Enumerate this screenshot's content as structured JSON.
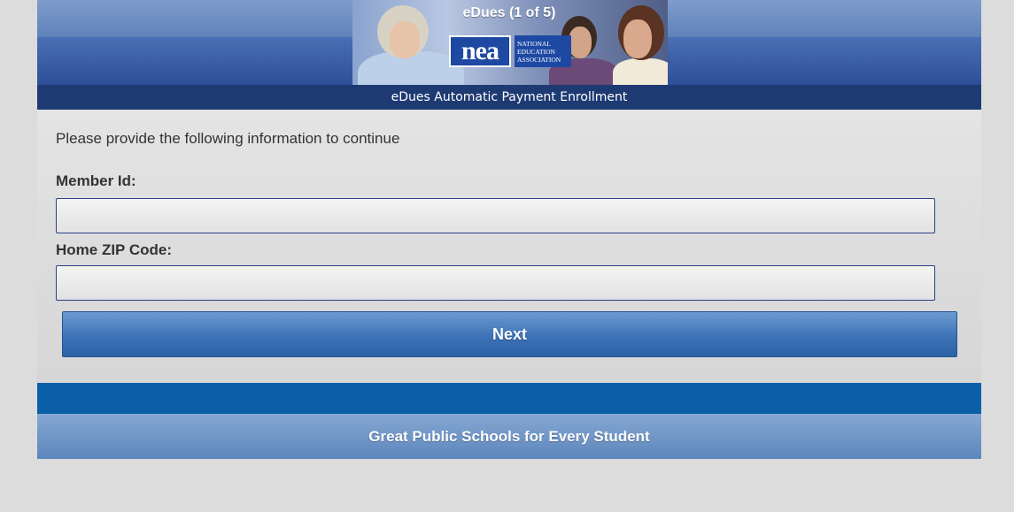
{
  "header": {
    "step_title": "eDues (1 of 5)",
    "logo": {
      "mark": "nea",
      "words": [
        "NATIONAL",
        "EDUCATION",
        "ASSOCIATION"
      ]
    },
    "subtitle": "eDues Automatic Payment Enrollment"
  },
  "form": {
    "intro": "Please provide the following information to continue",
    "member_id": {
      "label": "Member Id:",
      "value": ""
    },
    "zip": {
      "label": "Home ZIP Code:",
      "value": ""
    },
    "next_label": "Next"
  },
  "footer": {
    "tagline": "Great Public Schools for Every Student"
  },
  "colors": {
    "banner_blue": "#3f62a8",
    "subtitle_bar": "#1e3a73",
    "button_blue": "#3c73b6",
    "footer_bar": "#0b5fa8",
    "footer_tag": "#6f95c6",
    "page_bg": "#dcdcdc"
  }
}
